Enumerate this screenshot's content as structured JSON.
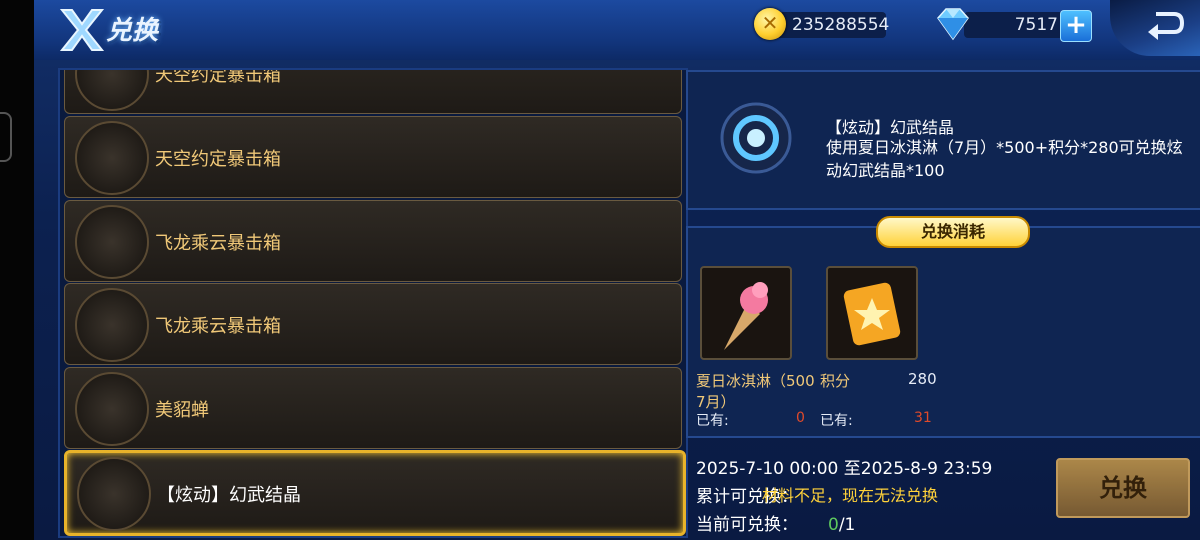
{
  "header": {
    "title": "兑换",
    "gold": "235288554",
    "gems": "7517"
  },
  "items": [
    {
      "name": "天空约定暴击箱",
      "selected": false
    },
    {
      "name": "天空约定暴击箱",
      "selected": false
    },
    {
      "name": "飞龙乘云暴击箱",
      "selected": false
    },
    {
      "name": "飞龙乘云暴击箱",
      "selected": false
    },
    {
      "name": "美貂蝉",
      "selected": false
    },
    {
      "name": "【炫动】幻武结晶",
      "selected": true
    }
  ],
  "detail": {
    "title": "【炫动】幻武结晶",
    "desc": "使用夏日冰淇淋（7月）*500+积分*280可兑换炫动幻武结晶*100"
  },
  "cost": {
    "title": "兑换消耗",
    "materials": [
      {
        "name": "夏日冰淇淋（500\n7月）",
        "name_line1": "夏日冰淇淋（500",
        "name_line2": "7月）",
        "need": "",
        "have_label": "已有:",
        "have": "0"
      },
      {
        "name": "积分",
        "need": "280",
        "have_label": "已有:",
        "have": "31"
      }
    ]
  },
  "info": {
    "period": "2025-7-10 00:00 至2025-8-9 23:59",
    "total_label": "累计可兑换：",
    "current_label": "当前可兑换：",
    "current_have": "0",
    "current_total": "/1",
    "message": "材料不足，现在无法兑换"
  },
  "button": {
    "exchange": "兑换"
  },
  "colors": {
    "gold_text": "#f0c878",
    "selected_border": "#e8b32a",
    "warning": "#ffd23a",
    "green": "#5ec85e",
    "red": "#e04a2a"
  }
}
